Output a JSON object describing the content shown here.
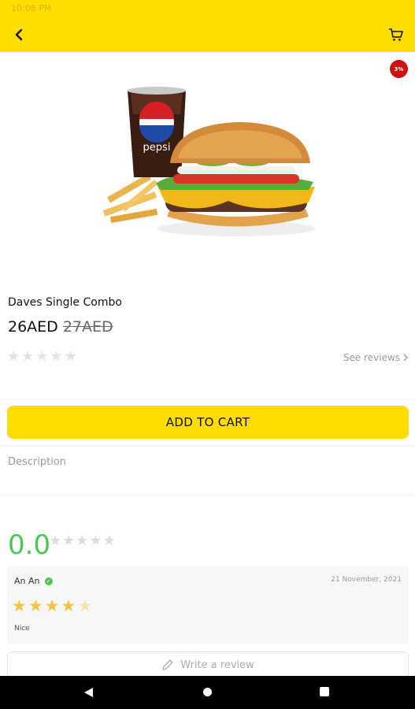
{
  "status_bar": {
    "time": "10:08 PM",
    "right": ""
  },
  "colors": {
    "accent": "#ffdd00",
    "rating_green": "#4cc653",
    "star_gold": "#f6c443",
    "badge_red": "#cc1111"
  },
  "header": {
    "back_icon": "chevron-left-icon",
    "cart_icon": "cart-icon"
  },
  "product": {
    "discount_badge": "3%",
    "title": "Daves Single Combo",
    "price": "26AED",
    "old_price": "27AED",
    "rating_stars": 0,
    "see_reviews": "See reviews"
  },
  "actions": {
    "add_to_cart": "ADD TO CART"
  },
  "description": {
    "label": "Description"
  },
  "ratings": {
    "average": "0.0",
    "reviews": [
      {
        "name": "An An",
        "verified": true,
        "date": "21 November, 2021",
        "stars": 4,
        "text": "Nice"
      }
    ],
    "write_review": "Write a review"
  }
}
